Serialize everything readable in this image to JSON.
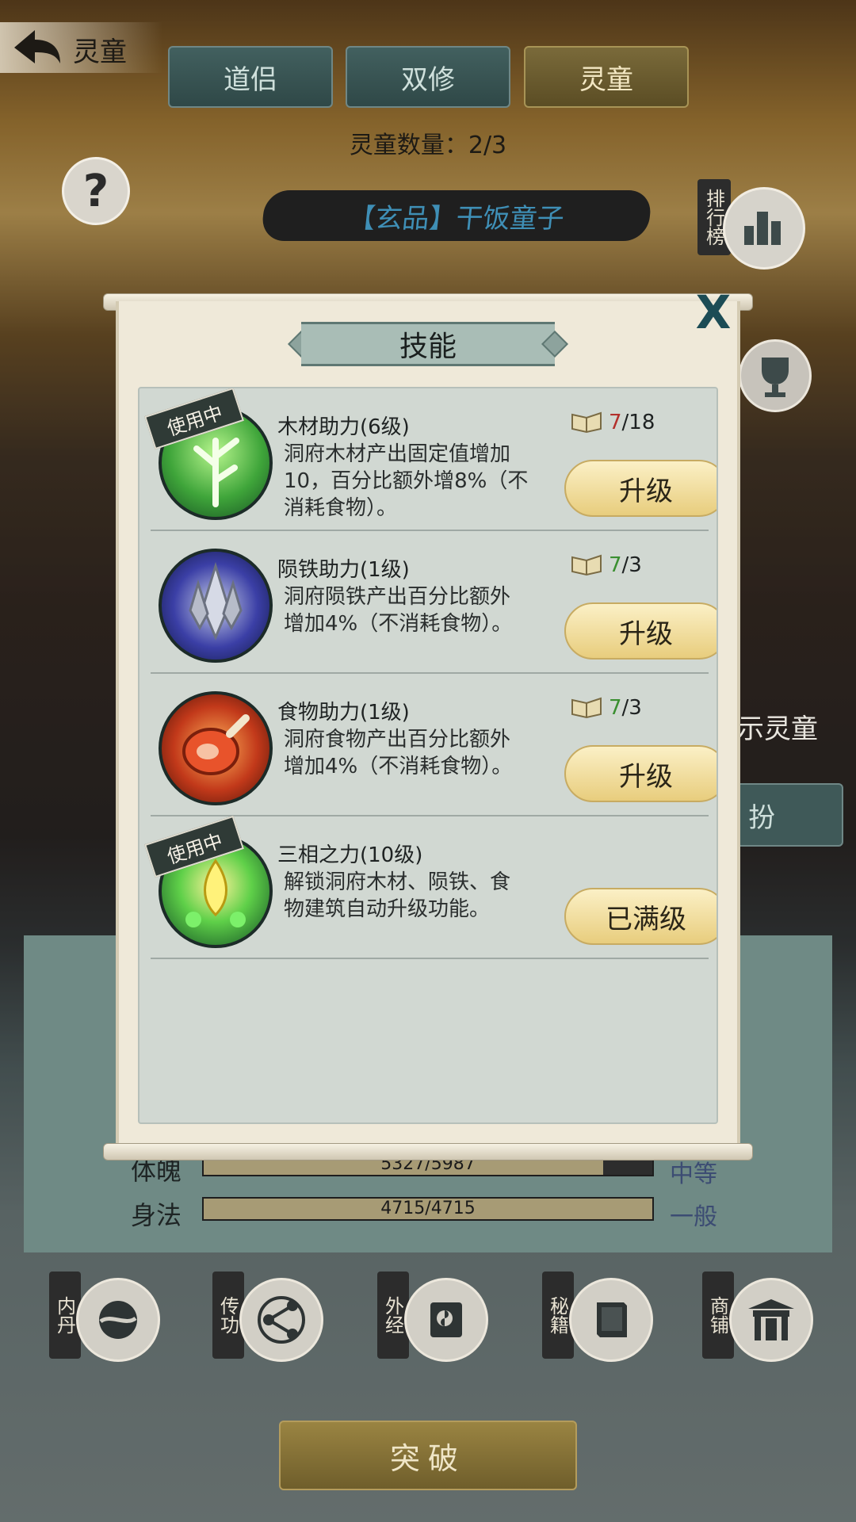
{
  "header": {
    "back_title": "灵童",
    "tabs": [
      "道侣",
      "双修",
      "灵童"
    ],
    "count_label": "灵童数量：2/3",
    "spirit_name": "【玄品】干饭童子",
    "rank_label": "排行榜",
    "help_glyph": "?"
  },
  "side": {
    "show_text": "示灵童",
    "dress_button": "扮"
  },
  "stats": [
    {
      "label": "体魄",
      "value": "5327/5987",
      "fraction": 0.89,
      "grade": "中等"
    },
    {
      "label": "身法",
      "value": "4715/4715",
      "fraction": 1.0,
      "grade": "一般"
    }
  ],
  "bottom_nav": [
    "内丹",
    "传功",
    "外经",
    "秘籍",
    "商铺"
  ],
  "breakthrough_label": "突破",
  "modal": {
    "title": "技能",
    "close_glyph": "X",
    "skills": [
      {
        "name": "木材助力(6级)",
        "desc": "洞府木材产出固定值增加10，百分比额外增8%（不消耗食物）。",
        "have": "7",
        "need": "/18",
        "have_color": "low",
        "button": "升级",
        "in_use": "使用中"
      },
      {
        "name": "陨铁助力(1级)",
        "desc": "洞府陨铁产出百分比额外增加4%（不消耗食物）。",
        "have": "7",
        "need": "/3",
        "have_color": "ok",
        "button": "升级",
        "in_use": ""
      },
      {
        "name": "食物助力(1级)",
        "desc": "洞府食物产出百分比额外增加4%（不消耗食物）。",
        "have": "7",
        "need": "/3",
        "have_color": "ok",
        "button": "升级",
        "in_use": ""
      },
      {
        "name": "三相之力(10级)",
        "desc": "解锁洞府木材、陨铁、食物建筑自动升级功能。",
        "have": "",
        "need": "",
        "have_color": "",
        "button": "已满级",
        "in_use": "使用中"
      }
    ]
  }
}
